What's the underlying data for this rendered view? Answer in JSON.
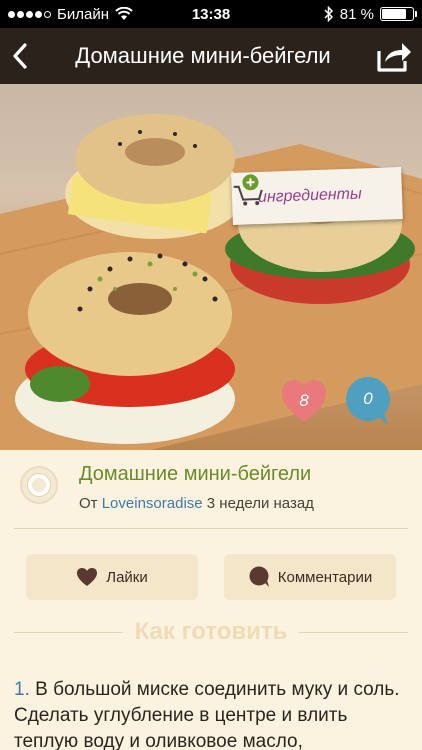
{
  "status": {
    "carrier": "Билайн",
    "time": "13:38",
    "battery_text": "81 %",
    "battery_level": 0.81
  },
  "nav": {
    "title": "Домашние мини-бейгели",
    "back_icon": "chevron-left-icon",
    "share_icon": "share-icon"
  },
  "hero": {
    "ingredients_label": "ингредиенты",
    "likes_count": "8",
    "comments_count": "0"
  },
  "recipe": {
    "title": "Домашние мини-бейгели",
    "by_prefix": "От",
    "author": "Loveinsoradise",
    "time_ago": "3 недели назад"
  },
  "actions": {
    "like_label": "Лайки",
    "comment_label": "Комментарии"
  },
  "howto": {
    "title": "Как готовить"
  },
  "steps": [
    {
      "number": "1.",
      "text": "В большой миске соединить муку и соль. Сделать углубление в центре и влить теплую воду и оливковое масло,"
    }
  ],
  "colors": {
    "nav_bg": "#2c221c",
    "accent_green": "#6a8b2a",
    "link_blue": "#3f7ba8",
    "like_pink": "#e9797a",
    "comment_blue": "#4f9fc0",
    "page_bg": "#fbf3df"
  }
}
